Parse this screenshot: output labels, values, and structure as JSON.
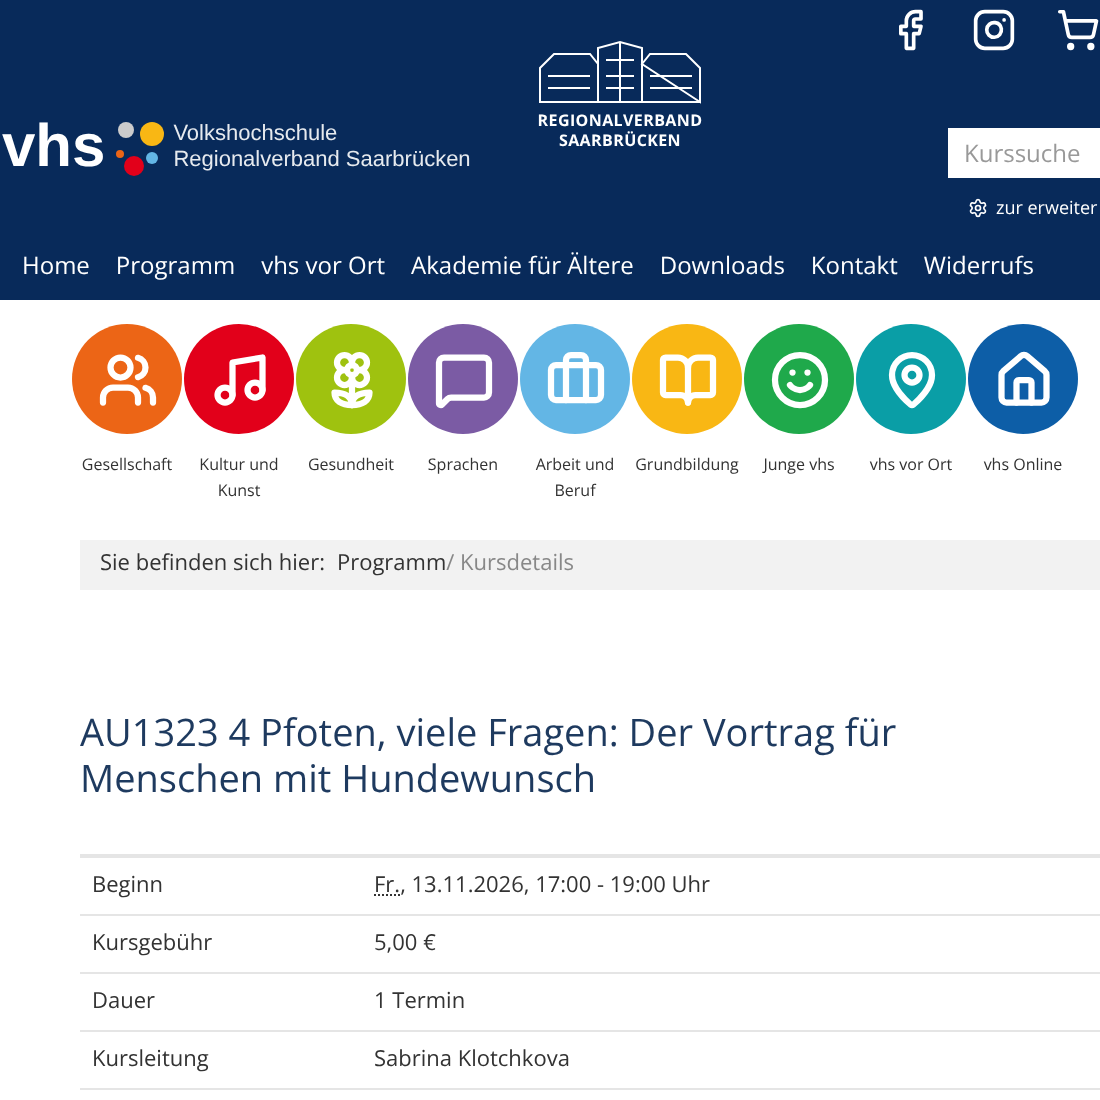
{
  "header": {
    "logo_text": "vhs",
    "org_line_1": "Volkshochschule",
    "org_line_2": "Regionalverband Saarbrücken",
    "emblem_line_1": "REGIONALVERBAND",
    "emblem_line_2": "SAARBRÜCKEN",
    "search": {
      "placeholder": "Kurssuche"
    },
    "advanced_link": "zur erweiter"
  },
  "nav": [
    "Home",
    "Programm",
    "vhs vor Ort",
    "Akademie für Ältere",
    "Downloads",
    "Kontakt",
    "Widerrufs"
  ],
  "categories": [
    {
      "label": "Gesellschaft",
      "color": "#ec6516"
    },
    {
      "label": "Kultur und Kunst",
      "color": "#e2001a"
    },
    {
      "label": "Gesundheit",
      "color": "#9fc20f"
    },
    {
      "label": "Sprachen",
      "color": "#7b5ba4"
    },
    {
      "label": "Arbeit und Beruf",
      "color": "#63b6e5"
    },
    {
      "label": "Grundbildung",
      "color": "#f9b714"
    },
    {
      "label": "Junge vhs",
      "color": "#1fa94b"
    },
    {
      "label": "vhs vor Ort",
      "color": "#0a9ea6"
    },
    {
      "label": "vhs Online",
      "color": "#0d5ea7"
    }
  ],
  "breadcrumb": {
    "prefix": "Sie befinden sich hier:",
    "link": "Programm",
    "current": "/ Kursdetails"
  },
  "title": "AU1323 4 Pfoten, viele Fragen: Der Vortrag für Menschen mit Hundewunsch",
  "details": [
    {
      "label": "Beginn",
      "day": "Fr.",
      "value": ", 13.11.2026, 17:00 - 19:00 Uhr"
    },
    {
      "label": "Kursgebühr",
      "value": "5,00 €"
    },
    {
      "label": "Dauer",
      "value": "1 Termin"
    },
    {
      "label": "Kursleitung",
      "value": "Sabrina Klotchkova"
    }
  ]
}
